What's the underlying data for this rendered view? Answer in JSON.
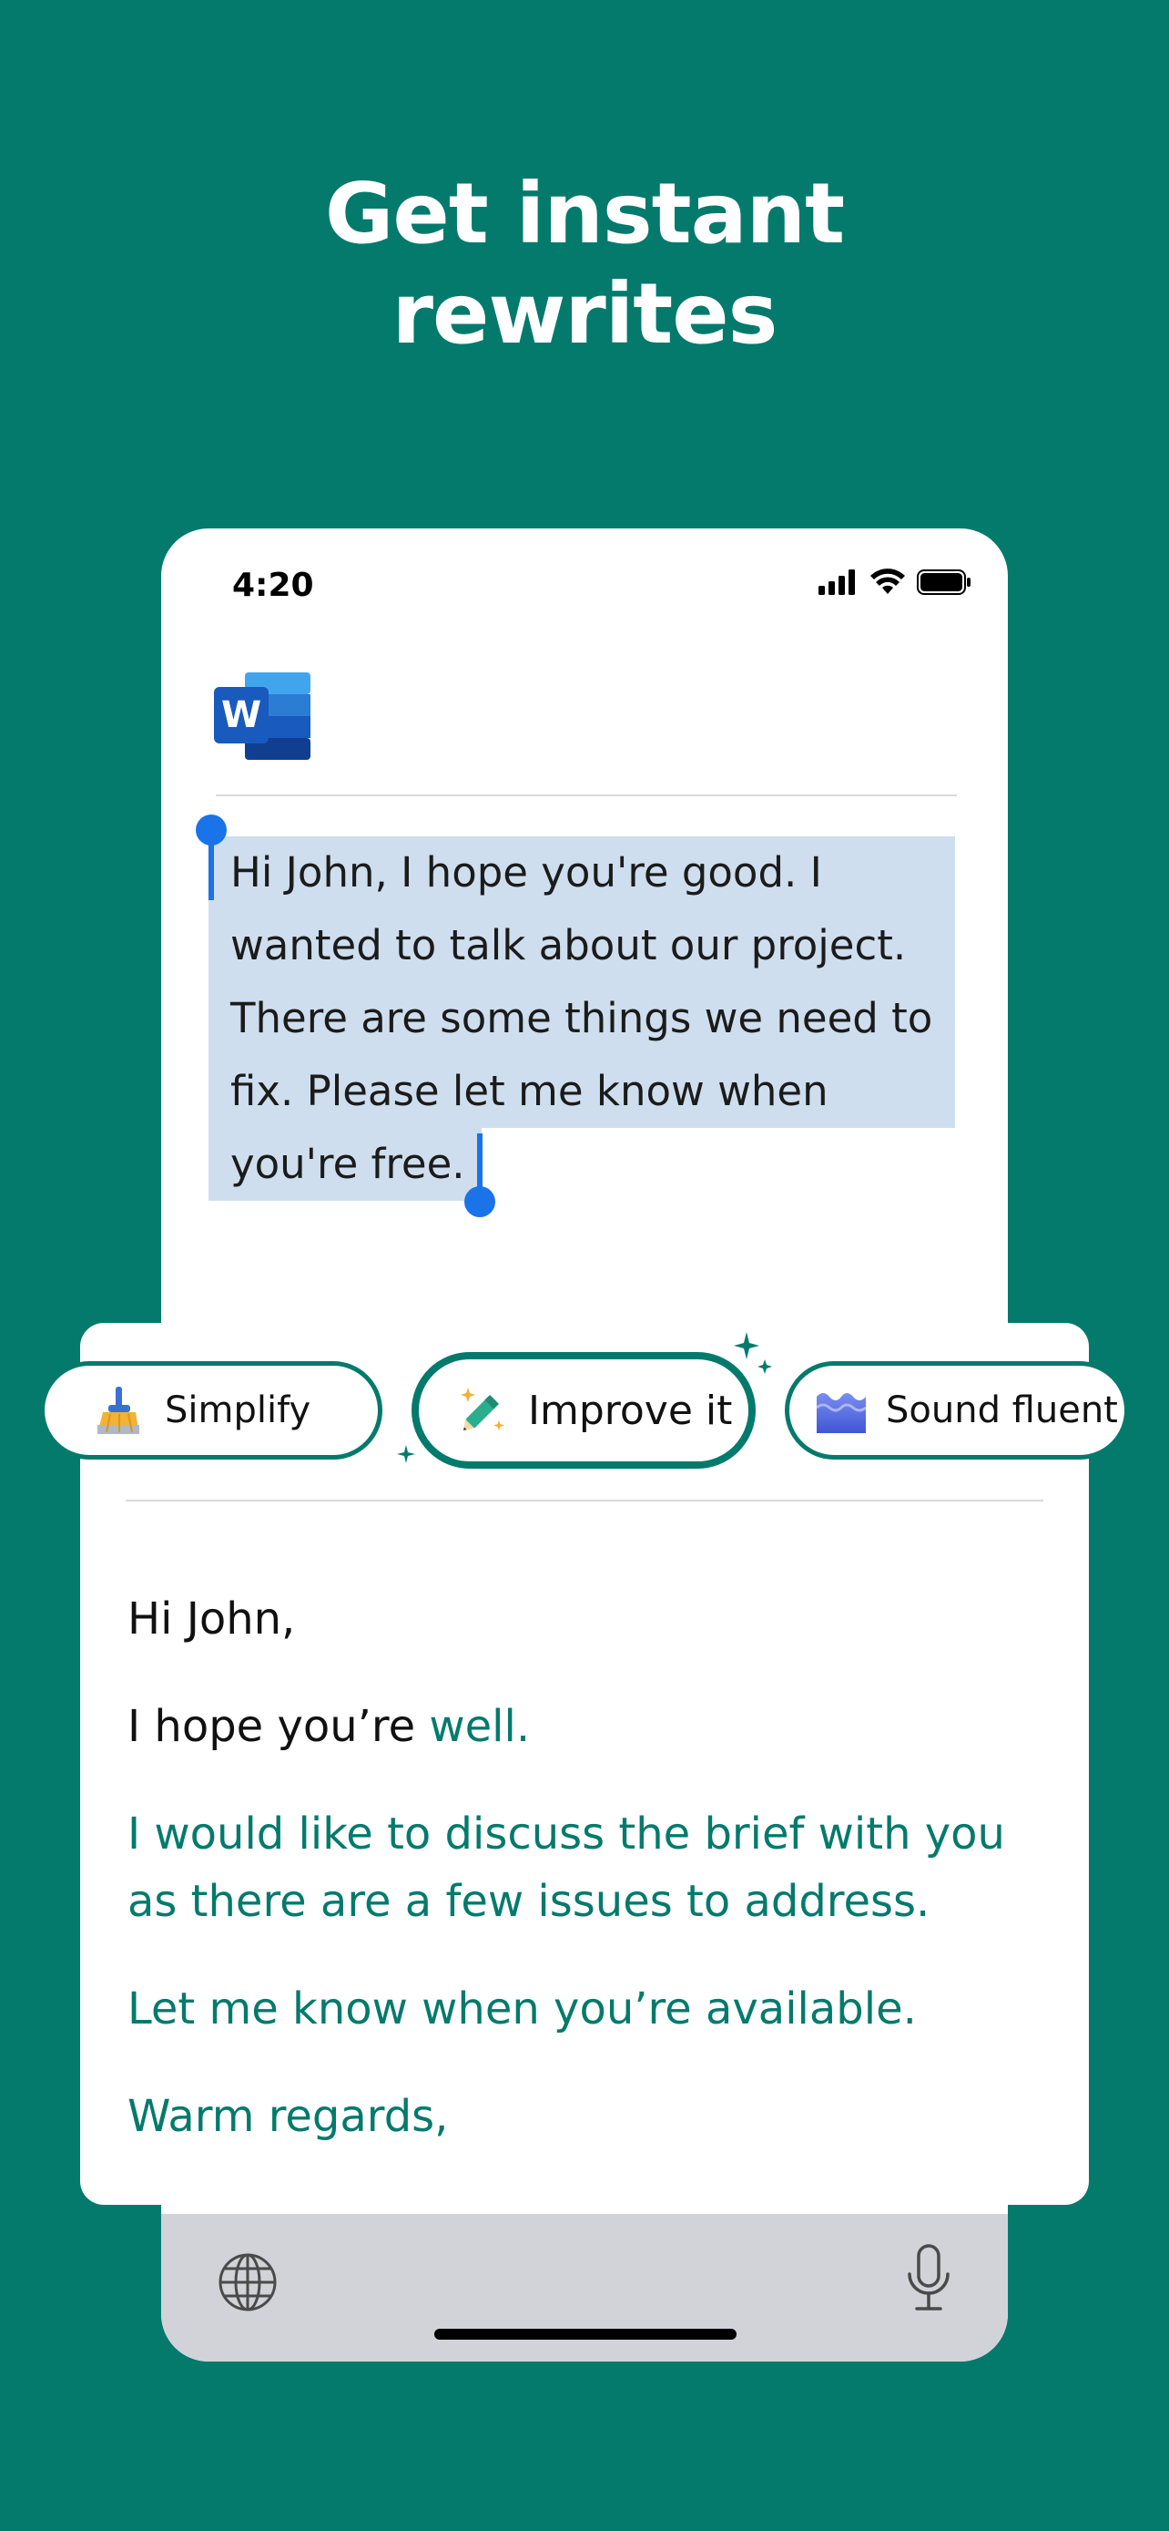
{
  "headline": {
    "line1": "Get instant",
    "line2": "rewrites"
  },
  "status_bar": {
    "time": "4:20",
    "icons": [
      "signal-icon",
      "wifi-icon",
      "battery-icon"
    ]
  },
  "document": {
    "app_icon": "word-icon",
    "selected_lines": [
      "Hi John, I hope you're good. I",
      "wanted to talk about our project.",
      "There are some things we need to",
      "fix. Please let me know when",
      "you're free."
    ]
  },
  "tone_options": {
    "simplify": {
      "label": "Simplify",
      "icon": "broom-icon"
    },
    "improve": {
      "label": "Improve it",
      "icon": "magic-pencil-icon",
      "selected": true
    },
    "fluent": {
      "label": "Sound fluent",
      "icon": "wave-icon"
    }
  },
  "rewrite": {
    "greeting": "Hi John,",
    "line2_unchanged": "I hope you’re",
    "line2_changed": "well.",
    "para3_line1": "I would like to discuss the brief with you",
    "para3_line2": "as there are a few issues to address.",
    "para4": "Let me know when you’re available.",
    "signoff": "Warm regards,"
  },
  "keyboard": {
    "left_icon": "globe-icon",
    "right_icon": "microphone-icon"
  },
  "colors": {
    "background": "#037A6C",
    "accent_green": "#037A6C",
    "selection_highlight": "#CEDEEE",
    "cursor_blue": "#1A73E8",
    "keyboard_gray": "#D2D3D9"
  }
}
